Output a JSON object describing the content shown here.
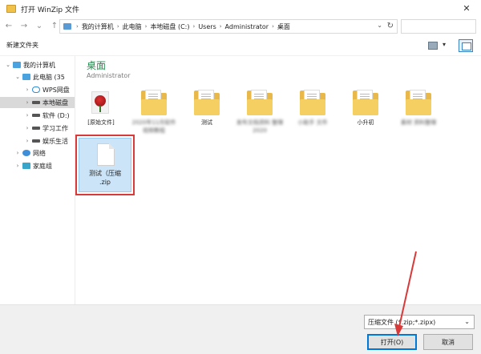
{
  "window": {
    "title": "打开 WinZip 文件",
    "close_label": "✕"
  },
  "nav_buttons": {
    "back": "←",
    "forward": "→",
    "recent": "⌄",
    "up": "↑"
  },
  "address": {
    "crumbs": [
      "我的计算机",
      "此电脑",
      "本地磁盘 (C:)",
      "Users",
      "Administrator",
      "桌面"
    ],
    "separator": "›",
    "dropdown": "⌄",
    "refresh": "↻"
  },
  "toolbar": {
    "new_folder": "新建文件夹",
    "view_dropdown": "▾"
  },
  "navpane": {
    "items": [
      {
        "label": "我的计算机",
        "chevron": "⌄",
        "icon": "pc-icon"
      },
      {
        "label": "此电脑 (35",
        "chevron": "⌄",
        "icon": "pc-icon"
      },
      {
        "label": "WPS网盘",
        "chevron": "›",
        "icon": "cloud-icon"
      },
      {
        "label": "本地磁盘",
        "chevron": "›",
        "icon": "disk-icon",
        "selected": true
      },
      {
        "label": "软件 (D:)",
        "chevron": "›",
        "icon": "disk-icon"
      },
      {
        "label": "学习工作",
        "chevron": "›",
        "icon": "disk-icon"
      },
      {
        "label": "娱乐生活",
        "chevron": "›",
        "icon": "disk-icon"
      },
      {
        "label": "网络",
        "chevron": "›",
        "icon": "network-icon"
      },
      {
        "label": "家庭组",
        "chevron": "›",
        "icon": "homegroup-icon"
      }
    ]
  },
  "content": {
    "folder_title": "桌面",
    "folder_subtitle": "Administrator",
    "tiles": [
      {
        "label": "[原始文件]",
        "kind": "image"
      },
      {
        "label": "2020年11月软件视频教程",
        "kind": "folder",
        "blurred": true
      },
      {
        "label": "测试",
        "kind": "folder"
      },
      {
        "label": "发布文档资料 整理 2020",
        "kind": "folder",
        "blurred": true
      },
      {
        "label": "小助手 文件",
        "kind": "folder",
        "blurred": true
      },
      {
        "label": "小升初",
        "kind": "folder"
      },
      {
        "label": "素材 资料整理",
        "kind": "folder",
        "blurred": true
      }
    ],
    "zip_file": {
      "label_line1": "测试（压缩",
      "label_line2": ".zip"
    }
  },
  "bottom": {
    "file_type": "压缩文件 (*.zip;*.zipx)",
    "file_type_arrow": "⌄",
    "open_button": "打开(O)",
    "cancel_button": "取消"
  },
  "colors": {
    "folder_title_green": "#1e8c4a",
    "highlight_red": "#d83a3a",
    "selection_blue": "#cce4f7",
    "primary_button_border": "#0078d7"
  }
}
